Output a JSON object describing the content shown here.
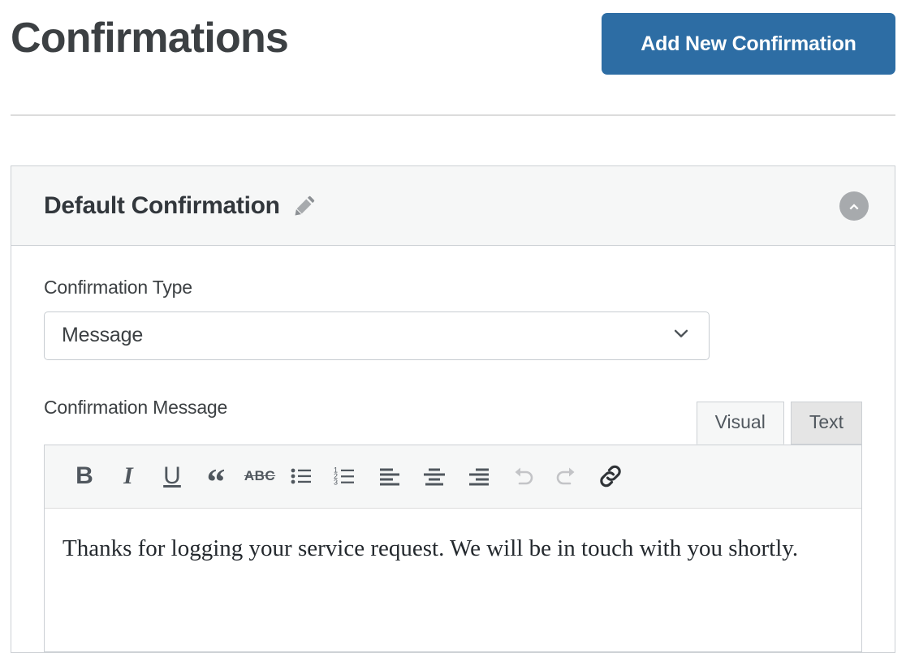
{
  "header": {
    "title": "Confirmations",
    "add_button_label": "Add New Confirmation"
  },
  "panel": {
    "title": "Default Confirmation",
    "edit_icon": "pencil-icon",
    "collapse_icon": "chevron-up-circle-icon",
    "fields": {
      "confirmation_type": {
        "label": "Confirmation Type",
        "selected_value": "Message",
        "dropdown_icon": "chevron-down-icon"
      },
      "confirmation_message": {
        "label": "Confirmation Message",
        "content": "Thanks for logging your service request. We will be in touch with you shortly."
      }
    },
    "editor": {
      "tabs": [
        {
          "label": "Visual",
          "active": true
        },
        {
          "label": "Text",
          "active": false
        }
      ],
      "toolbar": [
        {
          "name": "bold-icon",
          "glyph": "B",
          "style": "glyph-bold",
          "disabled": false
        },
        {
          "name": "italic-icon",
          "glyph": "I",
          "style": "glyph-italic",
          "disabled": false
        },
        {
          "name": "underline-icon",
          "glyph": "U",
          "style": "glyph-underline",
          "disabled": false
        },
        {
          "name": "blockquote-icon",
          "glyph": "“",
          "style": "glyph-quote",
          "disabled": false
        },
        {
          "name": "strikethrough-icon",
          "glyph": "ABC",
          "style": "glyph-strike",
          "disabled": false
        },
        {
          "name": "bulleted-list-icon",
          "glyph": "",
          "style": "svg-ul",
          "disabled": false
        },
        {
          "name": "numbered-list-icon",
          "glyph": "",
          "style": "svg-ol",
          "disabled": false
        },
        {
          "name": "align-left-icon",
          "glyph": "",
          "style": "svg-al",
          "disabled": false
        },
        {
          "name": "align-center-icon",
          "glyph": "",
          "style": "svg-ac",
          "disabled": false
        },
        {
          "name": "align-right-icon",
          "glyph": "",
          "style": "svg-ar",
          "disabled": false
        },
        {
          "name": "undo-icon",
          "glyph": "",
          "style": "svg-undo",
          "disabled": true
        },
        {
          "name": "redo-icon",
          "glyph": "",
          "style": "svg-redo",
          "disabled": true
        },
        {
          "name": "insert-link-icon",
          "glyph": "",
          "style": "svg-link",
          "disabled": false
        }
      ]
    }
  },
  "colors": {
    "accent_blue": "#2d6da4",
    "panel_header_bg": "#f6f7f7",
    "border": "#ccd0d4",
    "text_dark": "#32373c",
    "icon_gray": "#a7aaad",
    "toolbar_icon": "#50575e",
    "toolbar_icon_disabled": "#c3c4c7"
  }
}
